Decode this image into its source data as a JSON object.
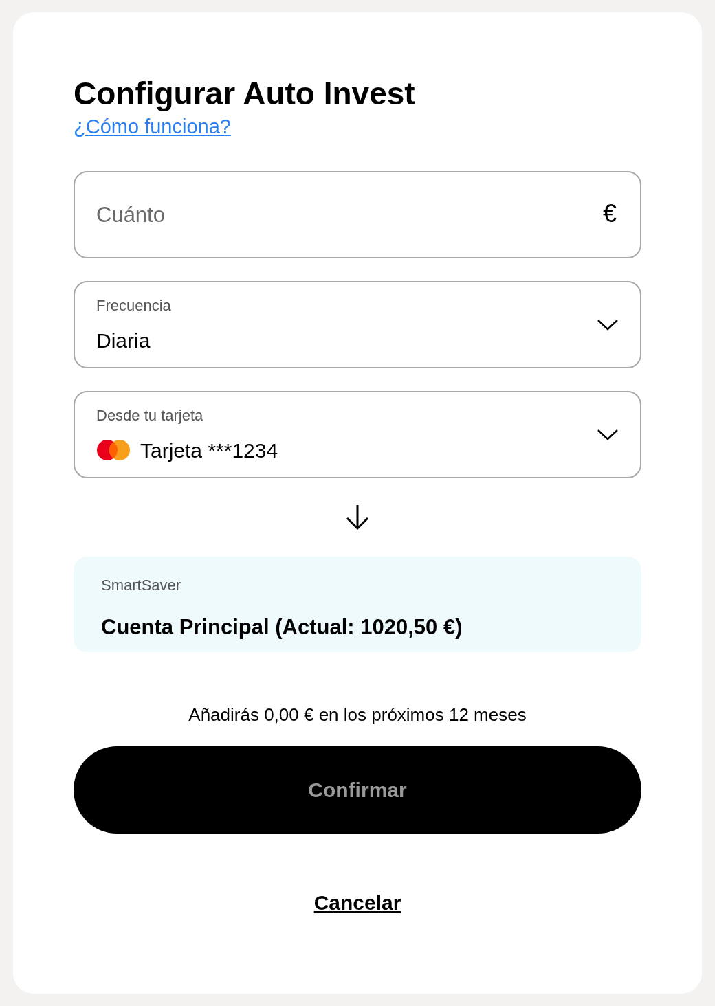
{
  "title": "Configurar Auto Invest",
  "help_link": "¿Cómo funciona?",
  "amount": {
    "placeholder": "Cuánto",
    "currency_symbol": "€"
  },
  "frequency": {
    "label": "Frecuencia",
    "value": "Diaria"
  },
  "source": {
    "label": "Desde tu tarjeta",
    "value": "Tarjeta ***1234"
  },
  "destination": {
    "label": "SmartSaver",
    "value": "Cuenta Principal (Actual: 1020,50 €)"
  },
  "summary": "Añadirás 0,00 € en los próximos 12 meses",
  "confirm_button": {
    "label": "Confirmar",
    "disabled": true
  },
  "cancel_link": "Cancelar"
}
